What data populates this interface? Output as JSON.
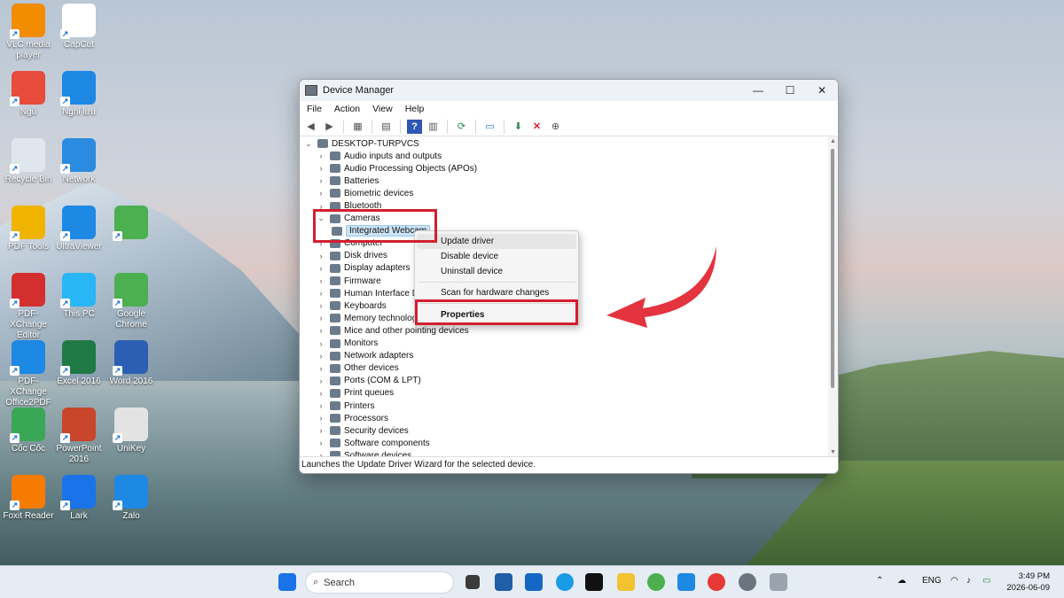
{
  "desktop": {
    "icons": [
      {
        "label": "VLC media player",
        "icon": "vlc-icon",
        "color": "#f28c00"
      },
      {
        "label": "CapCut",
        "icon": "capcut-icon",
        "color": "#ffffff"
      },
      {
        "label": "Ngủ",
        "icon": "power-icon",
        "color": "#e74c3c"
      },
      {
        "label": "Nghỉ lưu",
        "icon": "sleep-icon",
        "color": "#1e88e5"
      },
      {
        "label": "Recycle Bin",
        "icon": "recycle-bin-icon",
        "color": "#dfe6ee"
      },
      {
        "label": "Network",
        "icon": "network-icon",
        "color": "#2b8be0"
      },
      {
        "label": "PDF Tools",
        "icon": "pdf-tools-icon",
        "color": "#f0b400"
      },
      {
        "label": "UltraViewer",
        "icon": "ultraviewer-icon",
        "color": "#1e88e5"
      },
      {
        "label": "",
        "icon": "chrome-icon",
        "color": "#4caf50"
      },
      {
        "label": "PDF-XChange Editor",
        "icon": "pdf-xchange-icon",
        "color": "#d32f2f"
      },
      {
        "label": "This PC",
        "icon": "this-pc-icon",
        "color": "#29b6f6"
      },
      {
        "label": "Google Chrome",
        "icon": "chrome-icon",
        "color": "#4caf50"
      },
      {
        "label": "PDF-XChange Office2PDF",
        "icon": "office2pdf-icon",
        "color": "#1e88e5"
      },
      {
        "label": "Excel 2016",
        "icon": "excel-icon",
        "color": "#1f7a45"
      },
      {
        "label": "Word 2016",
        "icon": "word-icon",
        "color": "#2b5fb4"
      },
      {
        "label": "Cốc Cốc",
        "icon": "coccoc-icon",
        "color": "#3aa757"
      },
      {
        "label": "PowerPoint 2016",
        "icon": "powerpoint-icon",
        "color": "#c9452b"
      },
      {
        "label": "UniKey",
        "icon": "unikey-icon",
        "color": "#e3e3e3"
      },
      {
        "label": "Foxit Reader",
        "icon": "foxit-icon",
        "color": "#f57c00"
      },
      {
        "label": "Lark",
        "icon": "lark-icon",
        "color": "#1a73e8"
      },
      {
        "label": "Zalo",
        "icon": "zalo-icon",
        "color": "#1e88e5"
      }
    ]
  },
  "window": {
    "title": "Device Manager",
    "menu": [
      "File",
      "Action",
      "View",
      "Help"
    ],
    "root": "DESKTOP-TURPVCS",
    "tree": [
      {
        "label": "Audio inputs and outputs",
        "expanded": false
      },
      {
        "label": "Audio Processing Objects (APOs)",
        "expanded": false
      },
      {
        "label": "Batteries",
        "expanded": false
      },
      {
        "label": "Biometric devices",
        "expanded": false
      },
      {
        "label": "Bluetooth",
        "expanded": false
      },
      {
        "label": "Cameras",
        "expanded": true
      },
      {
        "label": "Integrated Webcam",
        "child": true
      },
      {
        "label": "Computer",
        "expanded": false
      },
      {
        "label": "Disk drives",
        "expanded": false
      },
      {
        "label": "Display adapters",
        "expanded": false
      },
      {
        "label": "Firmware",
        "expanded": false
      },
      {
        "label": "Human Interface De",
        "expanded": false
      },
      {
        "label": "Keyboards",
        "expanded": false
      },
      {
        "label": "Memory technolog",
        "expanded": false
      },
      {
        "label": "Mice and other pointing devices",
        "expanded": false
      },
      {
        "label": "Monitors",
        "expanded": false
      },
      {
        "label": "Network adapters",
        "expanded": false
      },
      {
        "label": "Other devices",
        "expanded": false
      },
      {
        "label": "Ports (COM & LPT)",
        "expanded": false
      },
      {
        "label": "Print queues",
        "expanded": false
      },
      {
        "label": "Printers",
        "expanded": false
      },
      {
        "label": "Processors",
        "expanded": false
      },
      {
        "label": "Security devices",
        "expanded": false
      },
      {
        "label": "Software components",
        "expanded": false
      },
      {
        "label": "Software devices",
        "expanded": false
      }
    ],
    "status": "Launches the Update Driver Wizard for the selected device."
  },
  "context_menu": {
    "items": [
      "Update driver",
      "Disable device",
      "Uninstall device",
      "Scan for hardware changes",
      "Properties"
    ],
    "highlighted": "Update driver",
    "bold": "Properties"
  },
  "annotation": {
    "color": "#d21f2f"
  },
  "taskbar": {
    "search_placeholder": "Search",
    "language": "ENG",
    "time": "3:49 PM",
    "date": "2026-06-09"
  }
}
